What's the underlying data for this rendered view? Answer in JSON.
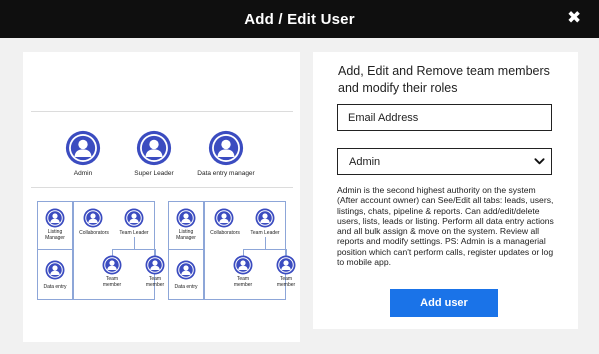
{
  "modal": {
    "title": "Add / Edit User",
    "close_glyph": "✖"
  },
  "org_chart": {
    "top_roles": [
      "Admin",
      "Super Leader",
      "Data entry manager"
    ],
    "group_left": {
      "listing_manager": "Listing\nManager",
      "data_entry": "Data entry",
      "collaborators": "Collaborators",
      "team_leader": "Team Leader",
      "team_member_1": "Team\nmember",
      "team_member_2": "Team\nmember"
    },
    "group_right": {
      "listing_manager": "Listing\nManager",
      "data_entry": "Data entry",
      "collaborators": "Collaborators",
      "team_leader": "Team Leader",
      "team_member_1": "Team\nmember",
      "team_member_2": "Team\nmember"
    }
  },
  "form": {
    "heading": "Add, Edit and Remove team members and modify their roles",
    "email_placeholder": "Email Address",
    "role_selected": "Admin",
    "description": "Admin is the second highest authority on the system (After account owner) can See/Edit all tabs: leads, users, listings, chats, pipeline & reports. Can add/edit/delete users, lists, leads or listing. Perform all data entry actions and all bulk assign & move on the system. Review all reports and modify settings. PS: Admin is a managerial position which can't perform calls, register updates or log to mobile app.",
    "submit_label": "Add user"
  },
  "colors": {
    "header_bg": "#0f0f0f",
    "avatar_blue": "#3b4cc0",
    "button_blue": "#1a73e8",
    "box_border": "#8da6d8"
  }
}
